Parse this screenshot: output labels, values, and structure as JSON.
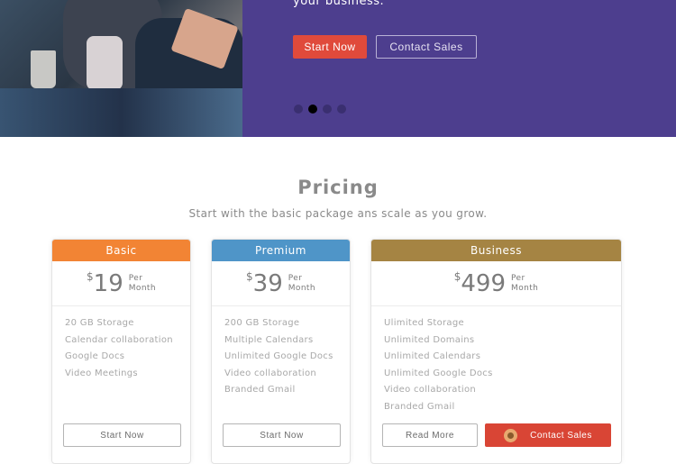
{
  "hero": {
    "tagline": "your business.",
    "start_label": "Start Now",
    "contact_label": "Contact Sales",
    "slides_active": 2,
    "slides_total": 4
  },
  "pricing": {
    "title": "Pricing",
    "subtitle": "Start with the basic package ans scale as you grow.",
    "plans": [
      {
        "name": "Basic",
        "color": "#f28434",
        "currency": "$",
        "amount": "19",
        "per1": "Per",
        "per2": "Month",
        "features": [
          "20 GB Storage",
          "Calendar collaboration",
          "Google Docs",
          "Video Meetings"
        ],
        "button": "Start Now"
      },
      {
        "name": "Premium",
        "color": "#4f95c8",
        "currency": "$",
        "amount": "39",
        "per1": "Per",
        "per2": "Month",
        "features": [
          "200 GB Storage",
          "Multiple Calendars",
          "Unlimited Google Docs",
          "Video collaboration",
          "Branded Gmail"
        ],
        "button": "Start Now"
      },
      {
        "name": "Business",
        "color": "#a58443",
        "currency": "$",
        "amount": "499",
        "per1": "Per",
        "per2": "Month",
        "features": [
          "Ulimited Storage",
          "Unlimited Domains",
          "Unlimited Calendars",
          "Unlimited Google Docs",
          "Video collaboration",
          "Branded Gmail"
        ],
        "button": "Read More",
        "button2": "Contact Sales"
      }
    ]
  }
}
